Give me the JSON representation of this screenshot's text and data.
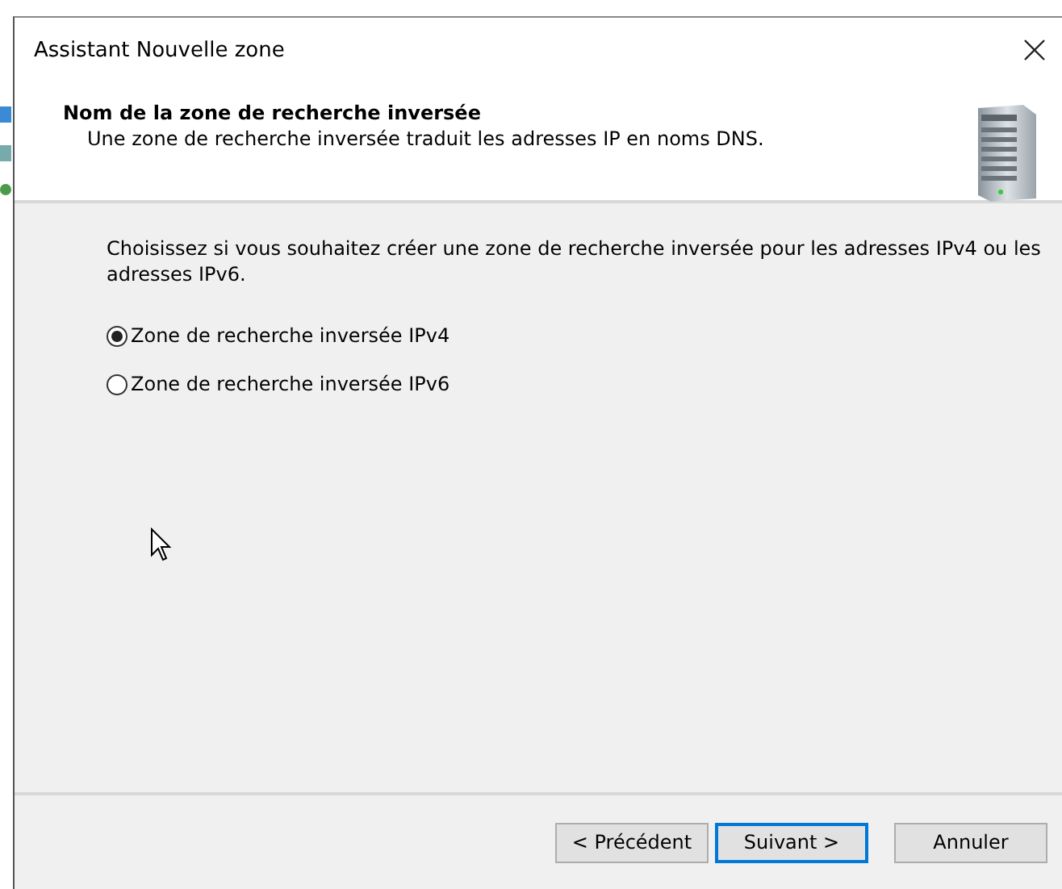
{
  "window": {
    "title": "Assistant Nouvelle zone"
  },
  "header": {
    "title": "Nom de la zone de recherche inversée",
    "subtitle": "Une zone de recherche inversée traduit les adresses IP en noms DNS."
  },
  "prompt": "Choisissez si vous souhaitez créer une zone de recherche inversée pour les adresses IPv4 ou les adresses IPv6.",
  "options": [
    {
      "label": "Zone de recherche inversée IPv4",
      "selected": true
    },
    {
      "label": "Zone de recherche inversée IPv6",
      "selected": false
    }
  ],
  "buttons": [
    {
      "label": "< Précédent",
      "default": false
    },
    {
      "label": "Suivant >",
      "default": true
    },
    {
      "label": "Annuler",
      "default": false
    }
  ]
}
